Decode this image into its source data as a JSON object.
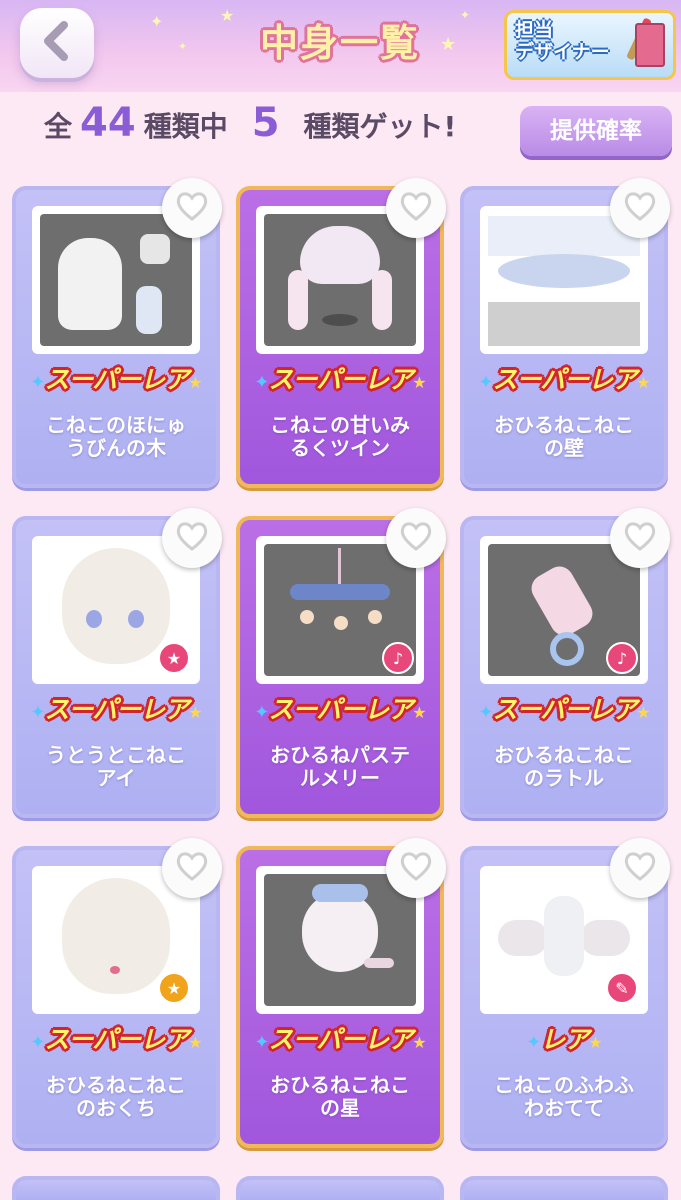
{
  "header": {
    "title": "中身一覧",
    "designer_button": "担当\nデザイナー"
  },
  "summary": {
    "prefix": "全",
    "total": "44",
    "middle": "種類中",
    "obtained": "5",
    "suffix": "種類ゲット!"
  },
  "rate_button": "提供確率",
  "colors": {
    "owned_card": "#a157dd",
    "unowned_card": "#aeb0f2",
    "accent_purple": "#8a5cd6",
    "rarity_red": "#d2252f"
  },
  "items": [
    {
      "name": "こねこのほにゅうびんの木",
      "line1": "こねこのほにゅ",
      "line2": "うびんの木",
      "rarity": "スーパーレア",
      "owned": false,
      "badge": ""
    },
    {
      "name": "こねこの甘いみるくツイン",
      "line1": "こねこの甘いみ",
      "line2": "るくツイン",
      "rarity": "スーパーレア",
      "owned": true,
      "badge": ""
    },
    {
      "name": "おひるねこねこの壁",
      "line1": "おひるねこねこ",
      "line2": "の壁",
      "rarity": "スーパーレア",
      "owned": false,
      "badge": ""
    },
    {
      "name": "うとうとこねこアイ",
      "line1": "うとうとこねこ",
      "line2": "アイ",
      "rarity": "スーパーレア",
      "owned": false,
      "badge": "star-icon"
    },
    {
      "name": "おひるねパステルメリー",
      "line1": "おひるねパステ",
      "line2": "ルメリー",
      "rarity": "スーパーレア",
      "owned": true,
      "badge": "music-note-icon"
    },
    {
      "name": "おひるねこねこのラトル",
      "line1": "おひるねこねこ",
      "line2": "のラトル",
      "rarity": "スーパーレア",
      "owned": false,
      "badge": "music-note-icon"
    },
    {
      "name": "おひるねこねこのおくち",
      "line1": "おひるねこねこ",
      "line2": "のおくち",
      "rarity": "スーパーレア",
      "owned": false,
      "badge": "star-icon"
    },
    {
      "name": "おひるねこねこの星",
      "line1": "おひるねこねこ",
      "line2": "の星",
      "rarity": "スーパーレア",
      "owned": true,
      "badge": ""
    },
    {
      "name": "こねこのふわふわおてて",
      "line1": "こねこのふわふ",
      "line2": "わおてて",
      "rarity": "レア",
      "owned": false,
      "badge": "brush-icon"
    }
  ]
}
